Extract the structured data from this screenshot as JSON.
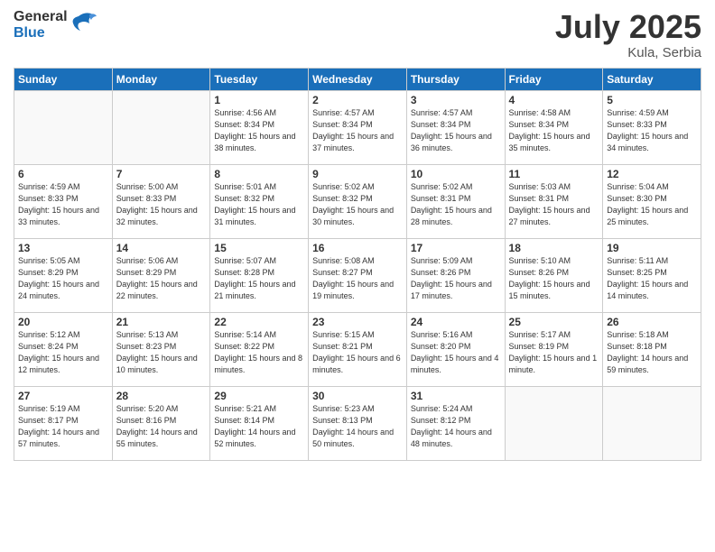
{
  "header": {
    "logo_general": "General",
    "logo_blue": "Blue",
    "month_title": "July 2025",
    "location": "Kula, Serbia"
  },
  "weekdays": [
    "Sunday",
    "Monday",
    "Tuesday",
    "Wednesday",
    "Thursday",
    "Friday",
    "Saturday"
  ],
  "weeks": [
    [
      {
        "day": "",
        "info": ""
      },
      {
        "day": "",
        "info": ""
      },
      {
        "day": "1",
        "info": "Sunrise: 4:56 AM\nSunset: 8:34 PM\nDaylight: 15 hours\nand 38 minutes."
      },
      {
        "day": "2",
        "info": "Sunrise: 4:57 AM\nSunset: 8:34 PM\nDaylight: 15 hours\nand 37 minutes."
      },
      {
        "day": "3",
        "info": "Sunrise: 4:57 AM\nSunset: 8:34 PM\nDaylight: 15 hours\nand 36 minutes."
      },
      {
        "day": "4",
        "info": "Sunrise: 4:58 AM\nSunset: 8:34 PM\nDaylight: 15 hours\nand 35 minutes."
      },
      {
        "day": "5",
        "info": "Sunrise: 4:59 AM\nSunset: 8:33 PM\nDaylight: 15 hours\nand 34 minutes."
      }
    ],
    [
      {
        "day": "6",
        "info": "Sunrise: 4:59 AM\nSunset: 8:33 PM\nDaylight: 15 hours\nand 33 minutes."
      },
      {
        "day": "7",
        "info": "Sunrise: 5:00 AM\nSunset: 8:33 PM\nDaylight: 15 hours\nand 32 minutes."
      },
      {
        "day": "8",
        "info": "Sunrise: 5:01 AM\nSunset: 8:32 PM\nDaylight: 15 hours\nand 31 minutes."
      },
      {
        "day": "9",
        "info": "Sunrise: 5:02 AM\nSunset: 8:32 PM\nDaylight: 15 hours\nand 30 minutes."
      },
      {
        "day": "10",
        "info": "Sunrise: 5:02 AM\nSunset: 8:31 PM\nDaylight: 15 hours\nand 28 minutes."
      },
      {
        "day": "11",
        "info": "Sunrise: 5:03 AM\nSunset: 8:31 PM\nDaylight: 15 hours\nand 27 minutes."
      },
      {
        "day": "12",
        "info": "Sunrise: 5:04 AM\nSunset: 8:30 PM\nDaylight: 15 hours\nand 25 minutes."
      }
    ],
    [
      {
        "day": "13",
        "info": "Sunrise: 5:05 AM\nSunset: 8:29 PM\nDaylight: 15 hours\nand 24 minutes."
      },
      {
        "day": "14",
        "info": "Sunrise: 5:06 AM\nSunset: 8:29 PM\nDaylight: 15 hours\nand 22 minutes."
      },
      {
        "day": "15",
        "info": "Sunrise: 5:07 AM\nSunset: 8:28 PM\nDaylight: 15 hours\nand 21 minutes."
      },
      {
        "day": "16",
        "info": "Sunrise: 5:08 AM\nSunset: 8:27 PM\nDaylight: 15 hours\nand 19 minutes."
      },
      {
        "day": "17",
        "info": "Sunrise: 5:09 AM\nSunset: 8:26 PM\nDaylight: 15 hours\nand 17 minutes."
      },
      {
        "day": "18",
        "info": "Sunrise: 5:10 AM\nSunset: 8:26 PM\nDaylight: 15 hours\nand 15 minutes."
      },
      {
        "day": "19",
        "info": "Sunrise: 5:11 AM\nSunset: 8:25 PM\nDaylight: 15 hours\nand 14 minutes."
      }
    ],
    [
      {
        "day": "20",
        "info": "Sunrise: 5:12 AM\nSunset: 8:24 PM\nDaylight: 15 hours\nand 12 minutes."
      },
      {
        "day": "21",
        "info": "Sunrise: 5:13 AM\nSunset: 8:23 PM\nDaylight: 15 hours\nand 10 minutes."
      },
      {
        "day": "22",
        "info": "Sunrise: 5:14 AM\nSunset: 8:22 PM\nDaylight: 15 hours\nand 8 minutes."
      },
      {
        "day": "23",
        "info": "Sunrise: 5:15 AM\nSunset: 8:21 PM\nDaylight: 15 hours\nand 6 minutes."
      },
      {
        "day": "24",
        "info": "Sunrise: 5:16 AM\nSunset: 8:20 PM\nDaylight: 15 hours\nand 4 minutes."
      },
      {
        "day": "25",
        "info": "Sunrise: 5:17 AM\nSunset: 8:19 PM\nDaylight: 15 hours\nand 1 minute."
      },
      {
        "day": "26",
        "info": "Sunrise: 5:18 AM\nSunset: 8:18 PM\nDaylight: 14 hours\nand 59 minutes."
      }
    ],
    [
      {
        "day": "27",
        "info": "Sunrise: 5:19 AM\nSunset: 8:17 PM\nDaylight: 14 hours\nand 57 minutes."
      },
      {
        "day": "28",
        "info": "Sunrise: 5:20 AM\nSunset: 8:16 PM\nDaylight: 14 hours\nand 55 minutes."
      },
      {
        "day": "29",
        "info": "Sunrise: 5:21 AM\nSunset: 8:14 PM\nDaylight: 14 hours\nand 52 minutes."
      },
      {
        "day": "30",
        "info": "Sunrise: 5:23 AM\nSunset: 8:13 PM\nDaylight: 14 hours\nand 50 minutes."
      },
      {
        "day": "31",
        "info": "Sunrise: 5:24 AM\nSunset: 8:12 PM\nDaylight: 14 hours\nand 48 minutes."
      },
      {
        "day": "",
        "info": ""
      },
      {
        "day": "",
        "info": ""
      }
    ]
  ]
}
